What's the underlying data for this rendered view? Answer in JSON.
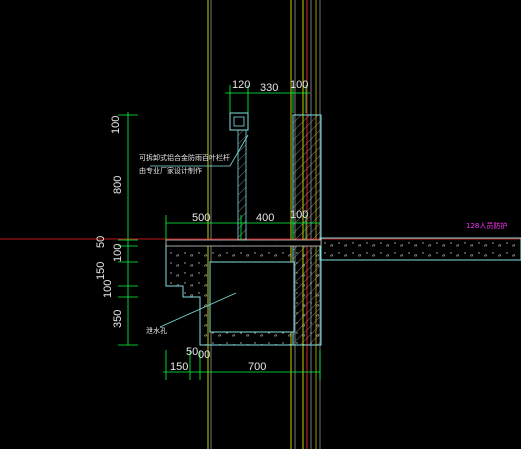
{
  "colors": {
    "background": "#000000",
    "dimension_green": "#00ff40",
    "structure_cyan": "#7fe0e0",
    "hatch": "#bfbfbf",
    "red_line": "#ff2020",
    "yellow_line": "#ffff00",
    "magenta_text": "#ff33ff",
    "white_text": "#e8e8e8"
  },
  "dimensions": {
    "top": [
      "120",
      "330",
      "100"
    ],
    "left_vertical": [
      "100",
      "800",
      "50",
      "100",
      "150",
      "100",
      "350"
    ],
    "middle": [
      "500",
      "400",
      "100"
    ],
    "bottom_small": [
      "50",
      "00"
    ],
    "bottom": [
      "150",
      "700"
    ]
  },
  "annotations": {
    "rail_note_line1": "可拆卸式铝合金防雨百叶栏杆",
    "rail_note_line2": "由专业厂家设计制作",
    "drain_note": "泄水孔",
    "magenta_label": "128人员防护"
  }
}
